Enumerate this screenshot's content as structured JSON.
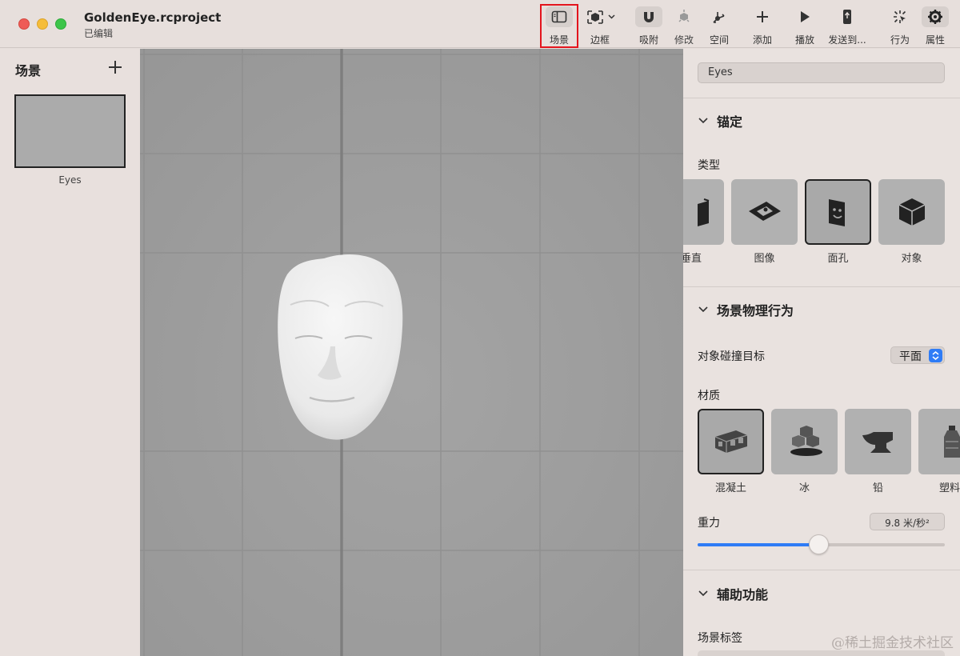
{
  "window": {
    "title": "GoldenEye.rcproject",
    "subtitle": "已编辑"
  },
  "toolbar": {
    "scene_label": "场景",
    "bounds_label": "边框",
    "snap_label": "吸附",
    "modify_label": "修改",
    "space_label": "空间",
    "add_label": "添加",
    "play_label": "播放",
    "send_label": "发送到...",
    "behaviors_label": "行为",
    "properties_label": "属性"
  },
  "scenes_panel": {
    "title": "场景",
    "items": [
      {
        "label": "Eyes"
      }
    ]
  },
  "inspector": {
    "name_value": "Eyes",
    "anchoring": {
      "heading": "锚定",
      "type_label": "类型",
      "options": [
        "垂直",
        "图像",
        "面孔",
        "对象"
      ],
      "selected": "面孔"
    },
    "physics": {
      "heading": "场景物理行为",
      "collision_label": "对象碰撞目标",
      "collision_value": "平面",
      "material_label": "材质",
      "materials": [
        "混凝土",
        "冰",
        "铅",
        "塑料"
      ],
      "selected_material": "混凝土",
      "gravity_label": "重力",
      "gravity_value": "9.8 米/秒²",
      "gravity_slider_fraction": 0.49
    },
    "accessibility": {
      "heading": "辅助功能",
      "scene_tag_label": "场景标签"
    }
  },
  "watermark": "@稀土掘金技术社区",
  "colors": {
    "accent": "#2f7cf6",
    "highlight": "#e3141d",
    "viewport_bg": "#9e9e9e"
  }
}
